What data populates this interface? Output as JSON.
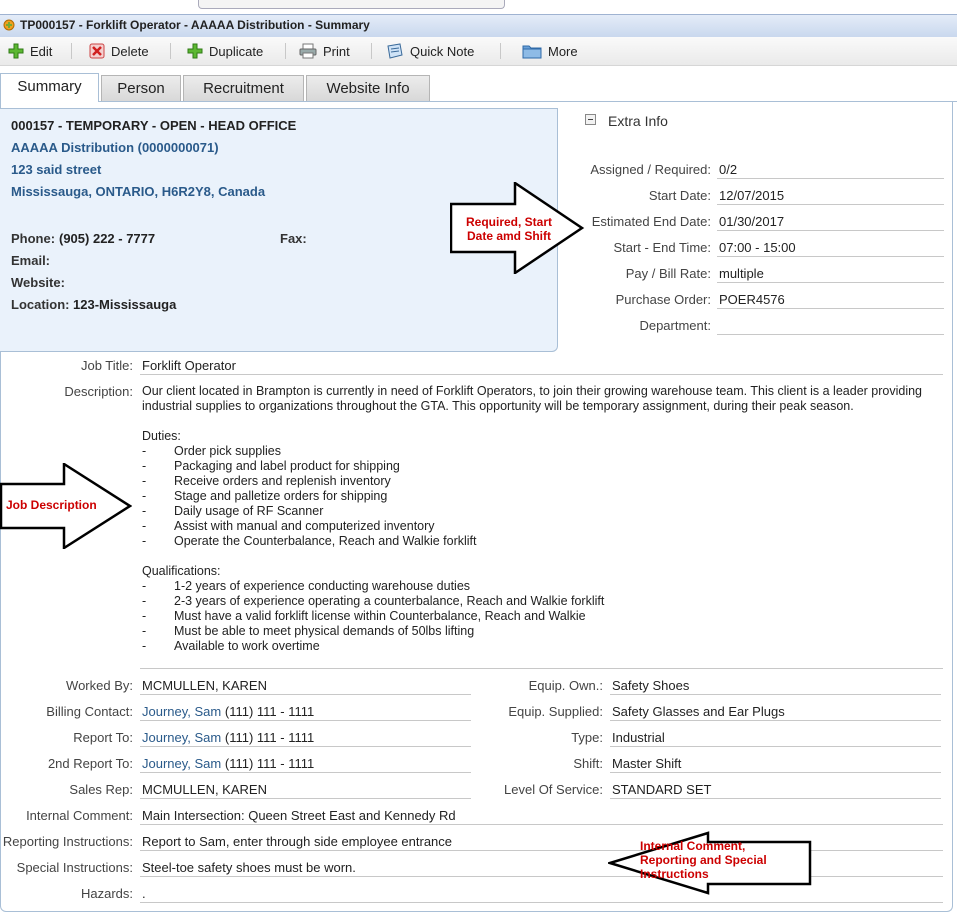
{
  "window": {
    "title": "TP000157 - Forklift Operator - AAAAA Distribution - Summary"
  },
  "toolbar": {
    "edit": "Edit",
    "delete": "Delete",
    "duplicate": "Duplicate",
    "print": "Print",
    "quick_note": "Quick Note",
    "more": "More"
  },
  "tabs": [
    "Summary",
    "Person",
    "Recruitment",
    "Website Info"
  ],
  "header": {
    "order_line": "000157 - TEMPORARY - OPEN - HEAD OFFICE",
    "company": "AAAAA Distribution (0000000071)",
    "street": "123 said street",
    "city": "Mississauga, ONTARIO, H6R2Y8, Canada",
    "phone_label": "Phone:",
    "phone_value": "(905) 222 - 7777",
    "fax_label": "Fax:",
    "email_label": "Email:",
    "website_label": "Website:",
    "location_label": "Location:",
    "location_value": "123-Mississauga"
  },
  "extra_info": {
    "title": "Extra Info",
    "fields": [
      {
        "label": "Assigned / Required:",
        "value": "0/2"
      },
      {
        "label": "Start Date:",
        "value": "12/07/2015"
      },
      {
        "label": "Estimated End Date:",
        "value": "01/30/2017"
      },
      {
        "label": "Start - End Time:",
        "value": "07:00 - 15:00"
      },
      {
        "label": "Pay / Bill Rate:",
        "value": "multiple"
      },
      {
        "label": "Purchase Order:",
        "value": "POER4576"
      },
      {
        "label": "Department:",
        "value": ""
      }
    ]
  },
  "job": {
    "title_label": "Job Title:",
    "title_value": "Forklift Operator",
    "description_label": "Description:",
    "description_intro": "Our client located in Brampton is currently in need of Forklift Operators, to join their growing warehouse team. This client is a leader providing industrial supplies to organizations throughout the GTA. This opportunity will be temporary assignment, during their peak season.",
    "duties_title": "Duties:",
    "duties": [
      "Order pick supplies",
      "Packaging and label product for shipping",
      "Receive orders and replenish inventory",
      "Stage and palletize orders for shipping",
      "Daily usage of RF Scanner",
      "Assist with manual and computerized inventory",
      "Operate the Counterbalance, Reach and Walkie forklift"
    ],
    "qualifications_title": "Qualifications:",
    "qualifications": [
      "1-2 years of experience conducting warehouse duties",
      "2-3 years of experience operating a counterbalance, Reach and Walkie forklift",
      "Must have a valid forklift license within Counterbalance, Reach and Walkie",
      "Must be able to meet physical demands of 50lbs lifting",
      "Available to work overtime"
    ],
    "dash": "-"
  },
  "details_left": [
    {
      "label": "Worked By:",
      "value": "MCMULLEN, KAREN"
    },
    {
      "label": "Billing Contact:",
      "link": "Journey, Sam",
      "value": " (111) 111 - 1111"
    },
    {
      "label": "Report To:",
      "link": "Journey, Sam",
      "value": " (111) 111 - 1111"
    },
    {
      "label": "2nd Report To:",
      "link": "Journey, Sam",
      "value": " (111) 111 - 1111"
    },
    {
      "label": "Sales Rep:",
      "value": "MCMULLEN, KAREN"
    }
  ],
  "details_right": [
    {
      "label": "Equip. Own.:",
      "value": "Safety Shoes"
    },
    {
      "label": "Equip. Supplied:",
      "value": "Safety Glasses and Ear Plugs"
    },
    {
      "label": "Type:",
      "value": "Industrial"
    },
    {
      "label": "Shift:",
      "value": "Master Shift"
    },
    {
      "label": "Level Of Service:",
      "value": "STANDARD SET"
    }
  ],
  "details_bottom": [
    {
      "label": "Internal Comment:",
      "value": "Main Intersection: Queen Street East and Kennedy Rd"
    },
    {
      "label": "Reporting Instructions:",
      "value": "Report to Sam, enter through side employee entrance"
    },
    {
      "label": "Special Instructions:",
      "value": "Steel-toe safety shoes must be worn."
    },
    {
      "label": "Hazards:",
      "value": "."
    }
  ],
  "annotations": {
    "required": "Required, Start Date amd Shift",
    "job_description": "Job Description",
    "internal": "Internal Comment, Reporting and Special Instructions"
  },
  "colors": {
    "accent_blue": "#2a5a8a",
    "annotation_red": "#cc0000",
    "info_bg": "#eaf2fb"
  }
}
